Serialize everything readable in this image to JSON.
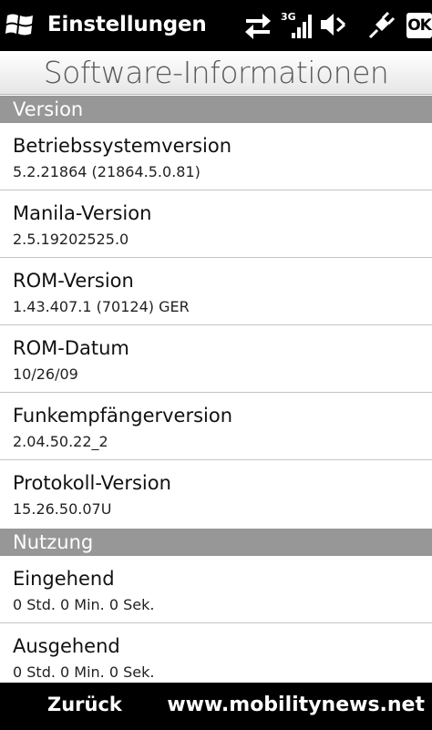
{
  "statusbar": {
    "app_title": "Einstellungen",
    "network_label": "3G",
    "ok_label": "OK"
  },
  "page": {
    "title": "Software-Informationen"
  },
  "sections": [
    {
      "title": "Version",
      "items": [
        {
          "label": "Betriebssystemversion",
          "value": "5.2.21864 (21864.5.0.81)"
        },
        {
          "label": "Manila-Version",
          "value": "2.5.19202525.0"
        },
        {
          "label": "ROM-Version",
          "value": "1.43.407.1 (70124) GER"
        },
        {
          "label": "ROM-Datum",
          "value": "10/26/09"
        },
        {
          "label": "Funkempfängerversion",
          "value": "2.04.50.22_2"
        },
        {
          "label": "Protokoll-Version",
          "value": "15.26.50.07U"
        }
      ]
    },
    {
      "title": "Nutzung",
      "items": [
        {
          "label": "Eingehend",
          "value": "0 Std. 0 Min. 0 Sek."
        },
        {
          "label": "Ausgehend",
          "value": "0 Std. 0 Min. 0 Sek."
        }
      ]
    }
  ],
  "bottombar": {
    "back_label": "Zurück",
    "watermark": "www.mobilitynews.net"
  }
}
